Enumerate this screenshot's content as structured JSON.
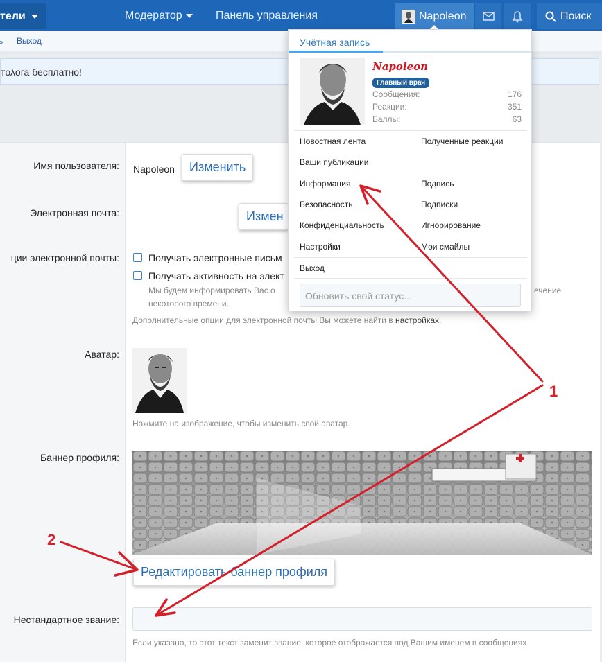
{
  "nav": {
    "left_label": "тели",
    "moderator": "Модератор",
    "control_panel": "Панель управления",
    "user": "Napoleon",
    "search": "Поиск"
  },
  "subbar": {
    "left_label": "ь",
    "logout": "Выход"
  },
  "notice": {
    "text": "тολога бесплатно!"
  },
  "form": {
    "username_label": "Имя пользователя:",
    "username_value": "Napoleon",
    "change_label": "Изменить",
    "email_label": "Электронная почта:",
    "email_change_label": "Измен",
    "email_options_label": "ции электронной почты:",
    "option1": "Получать электронные письм",
    "option2": "Получать активность на элект",
    "option2_hint_line1_left": "Мы будем информировать Вас о",
    "option2_hint_line1_right": "ечение",
    "option2_hint_line2": "некоторого времени.",
    "more_options_text": "Дополнительные опции для электронной почты Вы можете найти в",
    "more_options_link": "настройках",
    "more_options_end": ".",
    "avatar_label": "Аватар:",
    "avatar_hint": "Нажмите на изображение, чтобы изменить свой аватар.",
    "banner_label": "Баннер профиля:",
    "banner_button": "Редактировать баннер профиля",
    "custom_title_label": "Нестандартное звание:",
    "custom_title_value": "",
    "custom_title_hint": "Если указано, то этот текст заменит звание, которое отображается под Вашим именем в сообщениях."
  },
  "dropdown": {
    "tab": "Учётная запись",
    "name": "Napoleon",
    "badge": "Главный врач",
    "stats": [
      {
        "label": "Сообщения:",
        "value": "176"
      },
      {
        "label": "Реакции:",
        "value": "351"
      },
      {
        "label": "Баллы:",
        "value": "63"
      }
    ],
    "links": {
      "news_feed": "Новостная лента",
      "reactions_received": "Полученные реакции",
      "your_posts": "Ваши публикации",
      "information": "Информация",
      "signature": "Подпись",
      "security": "Безопасность",
      "subscriptions": "Подписки",
      "privacy": "Конфиденциальность",
      "ignoring": "Игнорирование",
      "settings": "Настройки",
      "smilies": "Мои смайлы",
      "logout": "Выход"
    },
    "status_placeholder": "Обновить свой статус..."
  },
  "annotations": {
    "one": "1",
    "two": "2"
  },
  "colors": {
    "nav_bg": "#1e67b8",
    "accent": "#2c6eb5",
    "arrow": "#d4202a",
    "name_red": "#d8121b"
  }
}
